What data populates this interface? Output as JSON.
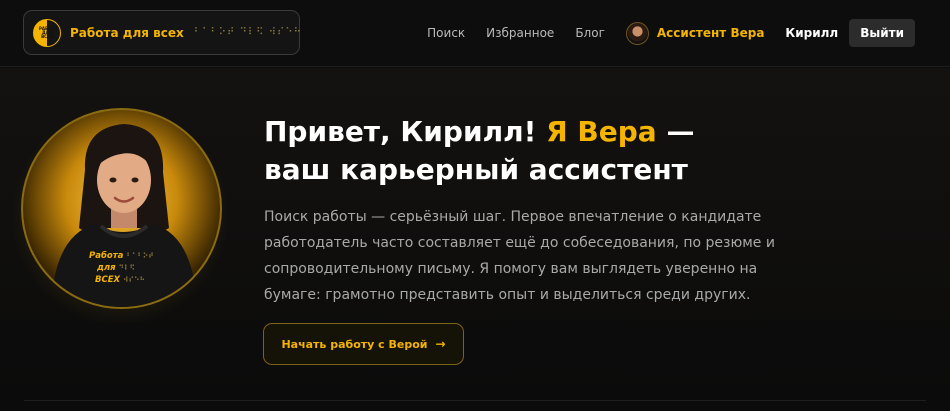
{
  "header": {
    "logo_mark_text": "РАБОТА ДЛЯ ВСЕХ",
    "logo_text": "Работа для всех",
    "logo_braille": "⠃⠁⠃⠕⠞ ⠙⠇⠫ ⠺⠎⠑⠓",
    "nav": [
      {
        "label": "Поиск"
      },
      {
        "label": "Избранное"
      },
      {
        "label": "Блог"
      }
    ],
    "assistant_label": "Ассистент Вера",
    "user_name": "Кирилл",
    "logout_label": "Выйти"
  },
  "hero": {
    "portrait_shirt_lines": [
      "Работа",
      "для",
      "ВСЕХ"
    ],
    "portrait_braille": [
      "⠃⠁⠃⠕⠞",
      "⠙⠇⠫",
      "⠺⠎⠑⠓"
    ],
    "title_part1": "Привет, Кирилл! ",
    "title_accent": "Я Вера",
    "title_part2": " —",
    "title_line2": "ваш карьерный ассистент",
    "description": "Поиск работы — серьёзный шаг. Первое впечатление о кандидате работодатель часто составляет ещё до собеседования, по резюме и сопроводительному письму. Я помогу вам выглядеть уверенно на бумаге: грамотно представить опыт и выделиться среди других.",
    "cta_label": "Начать работу с Верой",
    "cta_icon": "arrow-right-icon"
  },
  "colors": {
    "accent": "#f4b400",
    "background": "#0b0b0b",
    "text_muted": "#a9a9a9"
  }
}
